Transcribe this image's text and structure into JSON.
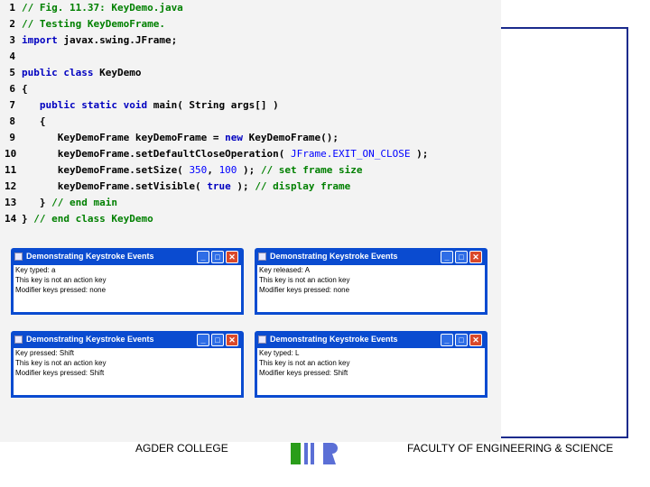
{
  "code": [
    {
      "num": "1",
      "parts": [
        {
          "t": "// Fig. 11.37: KeyDemo.java",
          "c": "cm"
        }
      ]
    },
    {
      "num": "2",
      "parts": [
        {
          "t": "// Testing KeyDemoFrame.",
          "c": "cm"
        }
      ]
    },
    {
      "num": "3",
      "parts": [
        {
          "t": "import",
          "c": "kw"
        },
        {
          "t": " javax.swing.JFrame;",
          "c": "tx"
        }
      ]
    },
    {
      "num": "4",
      "parts": []
    },
    {
      "num": "5",
      "parts": [
        {
          "t": "public class",
          "c": "kw"
        },
        {
          "t": " KeyDemo",
          "c": "tx"
        }
      ]
    },
    {
      "num": "6",
      "parts": [
        {
          "t": "{",
          "c": "tx"
        }
      ]
    },
    {
      "num": "7",
      "parts": [
        {
          "t": "   public static void",
          "c": "kw"
        },
        {
          "t": " main( String args[] )",
          "c": "tx"
        }
      ]
    },
    {
      "num": "8",
      "parts": [
        {
          "t": "   {",
          "c": "tx"
        }
      ]
    },
    {
      "num": "9",
      "parts": [
        {
          "t": "      KeyDemoFrame keyDemoFrame = ",
          "c": "tx"
        },
        {
          "t": "new",
          "c": "kw"
        },
        {
          "t": " KeyDemoFrame();",
          "c": "tx"
        }
      ]
    },
    {
      "num": "10",
      "parts": [
        {
          "t": "      keyDemoFrame.setDefaultCloseOperation( ",
          "c": "tx"
        },
        {
          "t": "JFrame.EXIT_ON_CLOSE",
          "c": "cn"
        },
        {
          "t": " );",
          "c": "tx"
        }
      ]
    },
    {
      "num": "11",
      "parts": [
        {
          "t": "      keyDemoFrame.setSize( ",
          "c": "tx"
        },
        {
          "t": "350",
          "c": "cn"
        },
        {
          "t": ", ",
          "c": "tx"
        },
        {
          "t": "100",
          "c": "cn"
        },
        {
          "t": " ); ",
          "c": "tx"
        },
        {
          "t": "// set frame size",
          "c": "cm"
        }
      ]
    },
    {
      "num": "12",
      "parts": [
        {
          "t": "      keyDemoFrame.setVisible( ",
          "c": "tx"
        },
        {
          "t": "true",
          "c": "kw"
        },
        {
          "t": " ); ",
          "c": "tx"
        },
        {
          "t": "// display frame",
          "c": "cm"
        }
      ]
    },
    {
      "num": "13",
      "parts": [
        {
          "t": "   } ",
          "c": "tx"
        },
        {
          "t": "// end main",
          "c": "cm"
        }
      ]
    },
    {
      "num": "14",
      "parts": [
        {
          "t": "} ",
          "c": "tx"
        },
        {
          "t": "// end class KeyDemo",
          "c": "cm"
        }
      ]
    }
  ],
  "windows": [
    {
      "title": "Demonstrating Keystroke Events",
      "lines": [
        "Key typed: a",
        "This key is not an action key",
        "Modifier keys pressed: none"
      ]
    },
    {
      "title": "Demonstrating Keystroke Events",
      "lines": [
        "Key released: A",
        "This key is not an action key",
        "Modifier keys pressed: none"
      ]
    },
    {
      "title": "Demonstrating Keystroke Events",
      "lines": [
        "Key pressed: Shift",
        "This key is not an action key",
        "Modifier keys pressed: Shift"
      ]
    },
    {
      "title": "Demonstrating Keystroke Events",
      "lines": [
        "Key typed: L",
        "This key is not an action key",
        "Modifier keys pressed: Shift"
      ]
    }
  ],
  "window_buttons": {
    "minimize": "_",
    "maximize": "□",
    "close": "✕"
  },
  "footer": {
    "left": "AGDER COLLEGE",
    "right": "FACULTY OF ENGINEERING & SCIENCE"
  },
  "colors": {
    "border": "#1a2a8c",
    "titlebar": "#0a4bd0",
    "comment": "#008000",
    "keyword": "#0000c0"
  }
}
